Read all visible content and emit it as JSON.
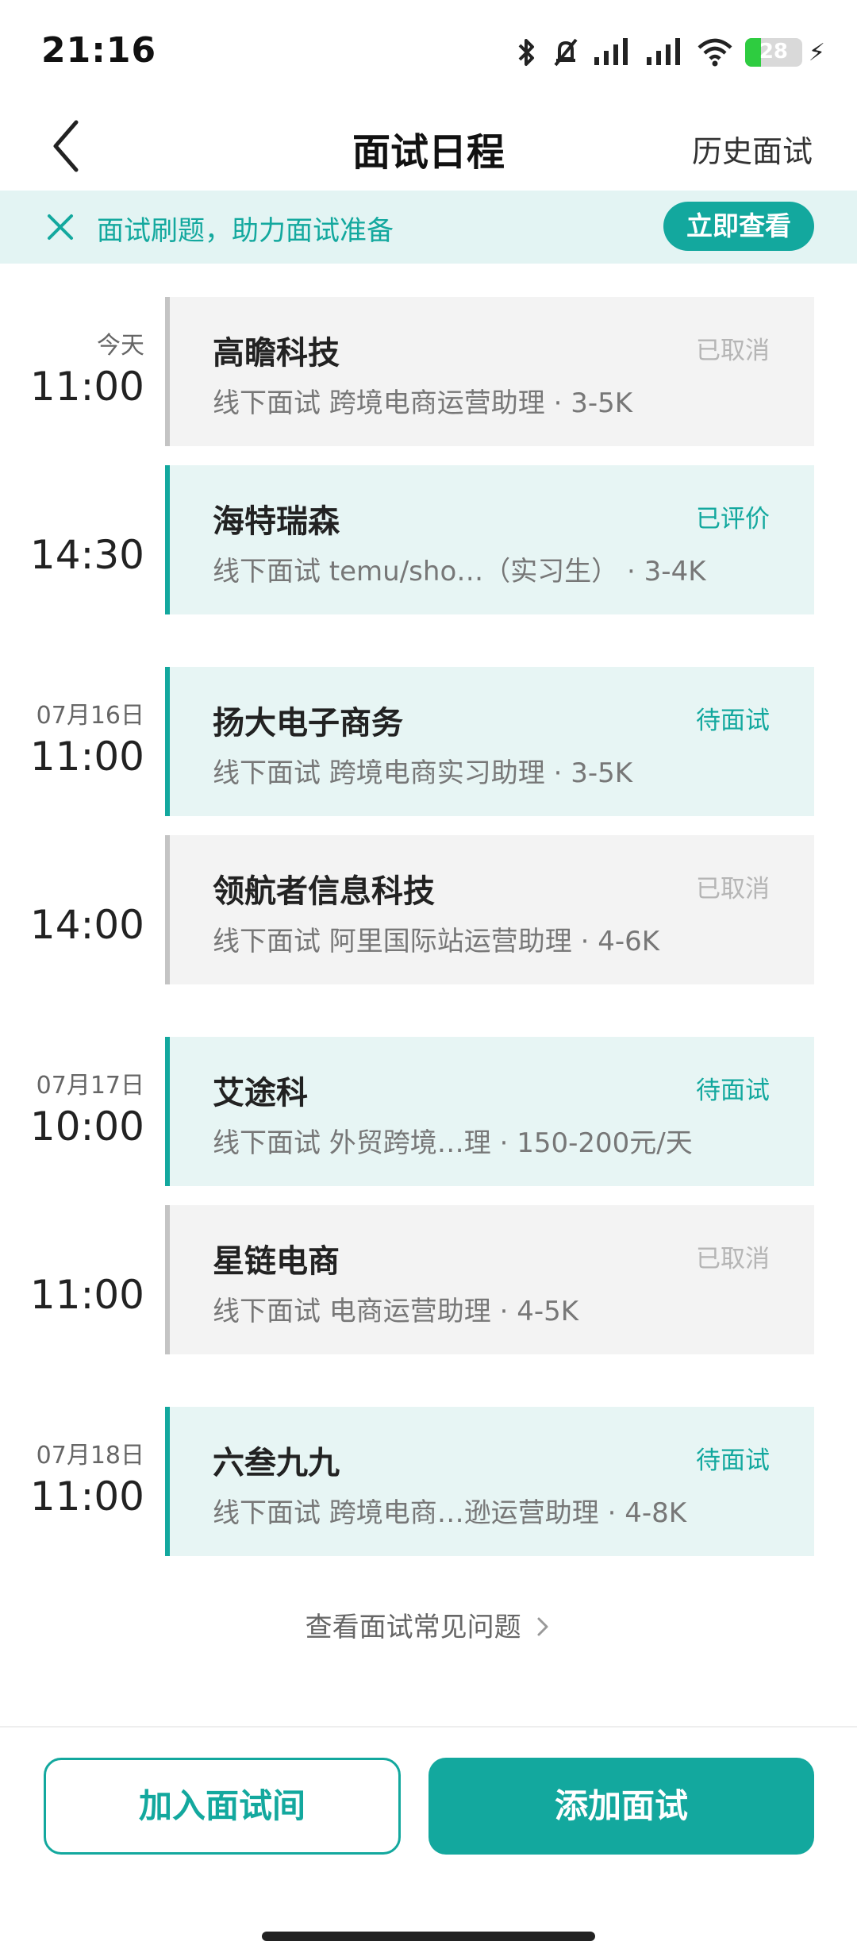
{
  "status_bar": {
    "time": "21:16",
    "battery_level": "28",
    "battery_fraction": 0.28,
    "icons": [
      "bluetooth-icon",
      "mute-icon",
      "signal-icon",
      "signal-icon",
      "wifi-icon",
      "battery-icon",
      "charging-icon"
    ],
    "battery_color": "#2ecc40"
  },
  "header": {
    "title": "面试日程",
    "history_label": "历史面试"
  },
  "banner": {
    "text": "面试刷题，助力面试准备",
    "button_label": "立即查看",
    "background_color": "#e3f4f3"
  },
  "interviews": [
    {
      "date": "今天",
      "time": "11:00",
      "company": "高瞻科技",
      "status": "已取消",
      "detail": "线下面试 跨境电商运营助理 · 3-5K",
      "state": "cancelled"
    },
    {
      "date": "",
      "time": "14:30",
      "company": "海特瑞森",
      "status": "已评价",
      "detail": "线下面试 temu/sho…（实习生） · 3-4K",
      "state": "active"
    },
    {
      "date": "07月16日",
      "time": "11:00",
      "company": "扬大电子商务",
      "status": "待面试",
      "detail": "线下面试 跨境电商实习助理 · 3-5K",
      "state": "active"
    },
    {
      "date": "",
      "time": "14:00",
      "company": "领航者信息科技",
      "status": "已取消",
      "detail": "线下面试 阿里国际站运营助理 · 4-6K",
      "state": "cancelled"
    },
    {
      "date": "07月17日",
      "time": "10:00",
      "company": "艾途科",
      "status": "待面试",
      "detail": "线下面试 外贸跨境…理 · 150-200元/天",
      "state": "active"
    },
    {
      "date": "",
      "time": "11:00",
      "company": "星链电商",
      "status": "已取消",
      "detail": "线下面试 电商运营助理 · 4-5K",
      "state": "cancelled"
    },
    {
      "date": "07月18日",
      "time": "11:00",
      "company": "六叁九九",
      "status": "待面试",
      "detail": "线下面试 跨境电商…逊运营助理 · 4-8K",
      "state": "active"
    }
  ],
  "faq_link": "查看面试常见问题",
  "bottom": {
    "join_label": "加入面试间",
    "add_label": "添加面试"
  },
  "colors": {
    "accent": "#13a89e",
    "active_card": "#e7f5f4",
    "cancelled_card": "#f3f3f3",
    "cancelled_text": "#b5b5b5"
  }
}
